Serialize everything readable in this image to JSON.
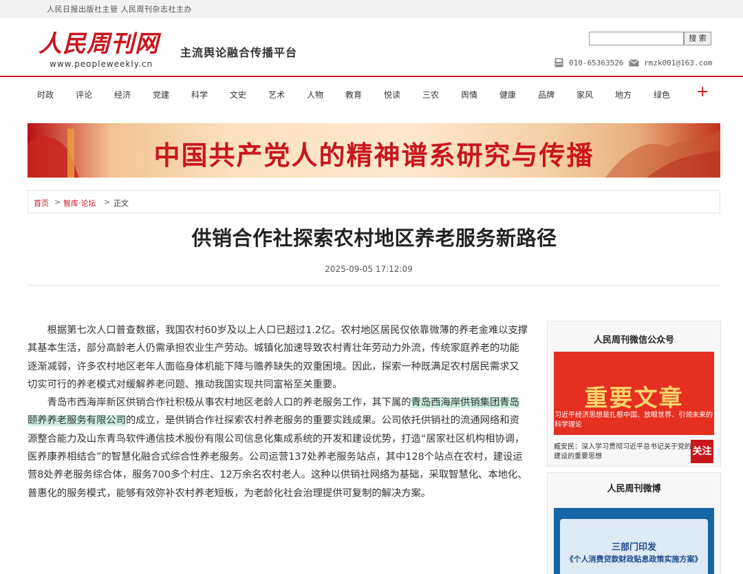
{
  "topbar": {
    "text": "人民日报出版社主管 人民周刊杂志社主办"
  },
  "header": {
    "logo_text": "人民周刊网",
    "logo_url": "www.peopleweekly.cn",
    "slogan": "主流舆论融合传播平台",
    "search_placeholder": "",
    "search_button": "搜 索",
    "phone": "010-65363526",
    "email": "rmzk001@163.com"
  },
  "nav": {
    "items": [
      "时政",
      "评论",
      "经济",
      "党建",
      "科学",
      "文史",
      "艺术",
      "人物",
      "教育",
      "悦读",
      "三农",
      "舆情",
      "健康",
      "品牌",
      "家风",
      "地方",
      "绿色"
    ],
    "more": "+"
  },
  "banner": {
    "text": "中国共产党人的精神谱系研究与传播"
  },
  "breadcrumb": {
    "home": "首页",
    "section": "智库·论坛",
    "current": "正文",
    "sep": ">"
  },
  "article": {
    "title": "供销合作社探索农村地区养老服务新路径",
    "date": "2025-09-05 17:12:09",
    "p1": "根据第七次人口普查数据，我国农村60岁及以上人口已超过1.2亿。农村地区居民仅依靠微薄的养老金难以支撑其基本生活，部分高龄老人仍需承担农业生产劳动。城镇化加速导致农村青壮年劳动力外流，传统家庭养老的功能逐渐减弱，许多农村地区老年人面临身体机能下降与赡养缺失的双重困境。因此，探索一种既满足农村居民需求又切实可行的养老模式对缓解养老问题、推动我国实现共同富裕至关重要。",
    "p2_before": "青岛市西海岸新区供销合作社积极从事农村地区老龄人口的养老服务工作，其下属的",
    "p2_highlight": "青岛西海岸供销集团青岛颐养养老服务有限公司",
    "p2_after": "的成立，是供销合作社探索农村养老服务的重要实践成果。公司依托供销社的流通网络和资源整合能力及山东青鸟软件通信技术股份有限公司信息化集成系统的开发和建设优势，打造“居家社区机构相协调，医养康养相结合”的智慧化融合式综合性养老服务。公司运营137处养老服务站点，其中128个站点在农村，建设运营8处养老服务综合体，服务700多个村庄、12万余名农村老人。这种以供销社网络为基础，采取智慧化、本地化、普惠化的服务模式，能够有效弥补农村养老短板，为老龄化社会治理提供可复制的解决方案。"
  },
  "sidebar": {
    "wechat": {
      "title": "人民周刊微信公众号",
      "card_big": "重要文章",
      "card_strip": "习近平经济思想是扎根中国、放眼世界、引领未来的科学理论",
      "news": "臧安民：深入学习贯彻习近平总书记关于党的建设的重要思想",
      "follow": "关注"
    },
    "weibo": {
      "title": "人民周刊微博",
      "card_line1": "三部门印发",
      "card_line2": "《个人消费贷款财政贴息政策实施方案》"
    }
  },
  "colors": {
    "brand_red": "#c8161d",
    "highlight": "#cdeee0",
    "weibo_blue": "#1565a7"
  }
}
